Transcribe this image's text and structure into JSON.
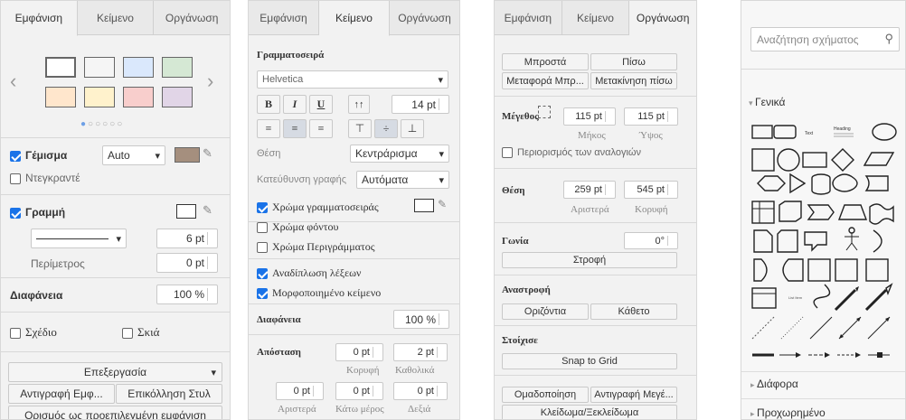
{
  "p1": {
    "tabs": [
      "Εμφάνιση",
      "Κείμενο",
      "Οργάνωση"
    ],
    "fill_label": "Γέμισμα",
    "fill_mode": "Auto",
    "gradient_label": "Ντεγκραντέ",
    "line_label": "Γραμμή",
    "line_width": "6 pt",
    "perimeter_label": "Περίμετρος",
    "perimeter_value": "0 pt",
    "opacity_label": "Διαφάνεια",
    "opacity_value": "100 %",
    "sketch_label": "Σχέδιο",
    "shadow_label": "Σκιά",
    "edit_label": "Επεξεργασία",
    "copy_style": "Αντιγραφή Εμφ...",
    "paste_style": "Επικόλληση Στυλ",
    "set_default": "Ορισμός ως προεπιλεγμένη εμφάνιση",
    "swatch_colors": [
      "#ffffff",
      "#f5f5f5",
      "#dae8fc",
      "#d5e8d4",
      "#ffe6cc",
      "#fff2cc",
      "#f8cecc",
      "#e1d5e7"
    ]
  },
  "p2": {
    "tabs": [
      "Εμφάνιση",
      "Κείμενο",
      "Οργάνωση"
    ],
    "font_title": "Γραμματοσειρά",
    "font_name": "Helvetica",
    "font_size": "14 pt",
    "bold": "B",
    "italic": "I",
    "underline": "U",
    "position_label": "Θέση",
    "position_value": "Κεντράρισμα",
    "direction_label": "Κατεύθυνση γραφής",
    "direction_value": "Αυτόματα",
    "font_color": "Χρώμα γραμματοσειράς",
    "bg_color": "Χρώμα φόντου",
    "border_color": "Χρώμα Περιγράμματος",
    "word_wrap": "Αναδίπλωση λέξεων",
    "formatted": "Μορφοποιημένο κείμενο",
    "opacity_label": "Διαφάνεια",
    "opacity_value": "100 %",
    "spacing_label": "Απόσταση",
    "top_value": "0 pt",
    "global_value": "2 pt",
    "top_label": "Κορυφή",
    "global_label": "Καθολικά",
    "left_value": "0 pt",
    "bottom_value": "0 pt",
    "right_value": "0 pt",
    "left_label": "Αριστερά",
    "bottom_label": "Κάτω μέρος",
    "right_label": "Δεξιά"
  },
  "p3": {
    "tabs": [
      "Εμφάνιση",
      "Κείμενο",
      "Οργάνωση"
    ],
    "front": "Μπροστά",
    "back": "Πίσω",
    "move_front": "Μεταφορά Μπρ...",
    "move_back": "Μετακίνηση πίσω",
    "size_label": "Μέγεθος",
    "width_value": "115 pt",
    "height_value": "115 pt",
    "width_label": "Μήκος",
    "height_label": "Ύψος",
    "constrain": "Περιορισμός των αναλογιών",
    "pos_label": "Θέση",
    "left_value": "259 pt",
    "top_value": "545 pt",
    "left_label": "Αριστερά",
    "top_label": "Κορυφή",
    "angle_label": "Γωνία",
    "angle_value": "0°",
    "rotate": "Στροφή",
    "flip_label": "Αναστροφή",
    "horizontal": "Οριζόντια",
    "vertical": "Κάθετο",
    "align_label": "Στοίχισε",
    "snap": "Snap to Grid",
    "group": "Ομαδοποίηση",
    "copy_size": "Αντιγραφή Μεγέ...",
    "lock": "Κλείδωμα/Ξεκλείδωμα"
  },
  "p4": {
    "search_placeholder": "Αναζήτηση σχήματος",
    "general": "Γενικά",
    "misc": "Διάφορα",
    "advanced": "Προχωρημένο",
    "text_shape": "Text",
    "heading_shape": "Heading",
    "list_item": "List Item"
  }
}
